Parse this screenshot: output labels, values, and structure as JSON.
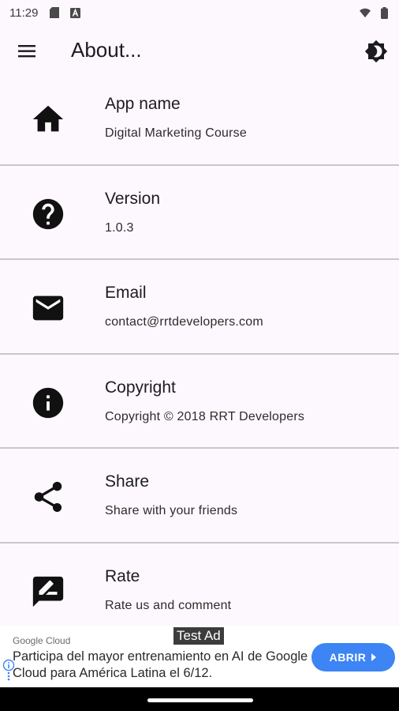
{
  "status_bar": {
    "time": "11:29",
    "icons": [
      "sd-card-icon",
      "a-box-icon",
      "wifi-icon",
      "battery-icon"
    ]
  },
  "app_bar": {
    "title": "About...",
    "menu_icon": "menu-icon",
    "theme_icon": "brightness-icon"
  },
  "items": [
    {
      "icon": "home-icon",
      "title": "App name",
      "subtitle": "Digital Marketing Course"
    },
    {
      "icon": "help-icon",
      "title": "Version",
      "subtitle": "1.0.3"
    },
    {
      "icon": "email-icon",
      "title": "Email",
      "subtitle": "contact@rrtdevelopers.com"
    },
    {
      "icon": "info-icon",
      "title": "Copyright",
      "subtitle": "Copyright © 2018 RRT Developers"
    },
    {
      "icon": "share-icon",
      "title": "Share",
      "subtitle": "Share with your friends"
    },
    {
      "icon": "rate-review-icon",
      "title": "Rate",
      "subtitle": "Rate us and comment"
    }
  ],
  "ad": {
    "label": "Test Ad",
    "advertiser": "Google Cloud",
    "headline": "Participa del mayor entrenamiento en AI de Google Cloud para América Latina el 6/12.",
    "cta": "ABRIR",
    "cta_color": "#3d84f5"
  },
  "colors": {
    "background": "#fdf8fd",
    "divider": "#c9c6cc",
    "text": "#1c1b1f"
  }
}
